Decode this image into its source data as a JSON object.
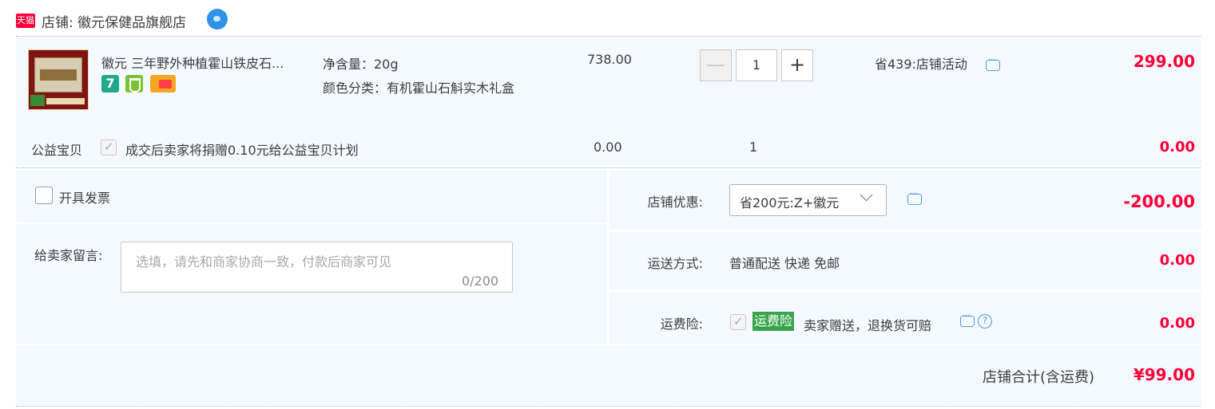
{
  "shop": {
    "badge": "天猫",
    "label": "店铺: 徽元保健品旗舰店"
  },
  "item": {
    "title": "徽元 三年野外种植霍山铁皮石...",
    "spec_weight": "净含量：20g",
    "spec_color": "颜色分类：有机霍山石斛实木礼盒",
    "price": "738.00",
    "quantity": "1",
    "minus": "—",
    "plus": "+",
    "promo": "省439:店铺活动",
    "subtotal": "299.00",
    "service_icons": [
      "seven-day-return-icon",
      "guarantee-shield-icon",
      "credit-card-icon"
    ],
    "seven_label": "7"
  },
  "charity": {
    "label": "公益宝贝",
    "text": "成交后卖家将捐赠0.10元给公益宝贝计划",
    "price": "0.00",
    "quantity": "1",
    "subtotal": "0.00"
  },
  "invoice": {
    "label": "开具发票"
  },
  "message": {
    "label": "给卖家留言:",
    "placeholder": "选填，请先和商家协商一致，付款后商家可见",
    "counter": "0/200"
  },
  "discount": {
    "label": "店铺优惠:",
    "selected": "省200元:Z+徽元",
    "value": "-200.00"
  },
  "shipping": {
    "label": "运送方式:",
    "method": "普通配送 快递 免邮",
    "value": "0.00"
  },
  "insurance": {
    "label": "运费险:",
    "tag": "运费险",
    "text": "卖家赠送，退换货可赔",
    "help": "?",
    "value": "0.00"
  },
  "total": {
    "label": "店铺合计(含运费)",
    "value": "¥99.00"
  },
  "colors": {
    "accent_red": "#ff0036",
    "panel_bg": "#f4f8ff",
    "link_blue": "#4a9ee3",
    "insurance_green": "#3aa44d"
  }
}
